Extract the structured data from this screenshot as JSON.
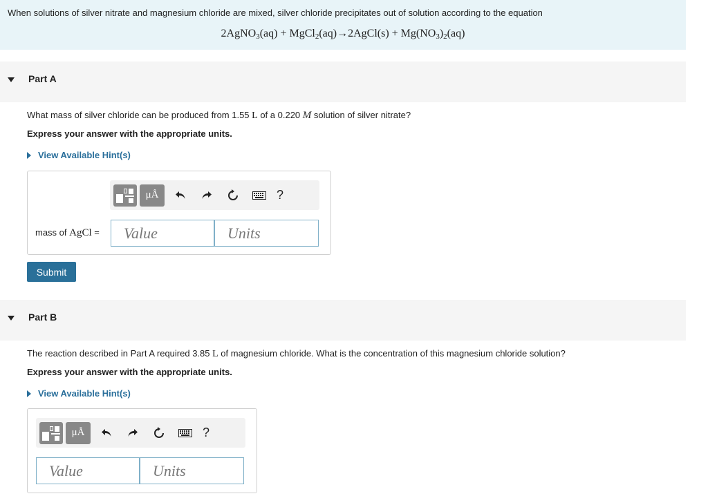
{
  "intro": {
    "text": "When solutions of silver nitrate and magnesium chloride are mixed, silver chloride precipitates out of solution according to the equation",
    "equation": {
      "p1": "2AgNO",
      "s1": "3",
      "p2": "(aq) + MgCl",
      "s2": "2",
      "p3": "(aq)→2AgCl(s) + Mg(NO",
      "s3": "3",
      "p4": ")",
      "s4": "2",
      "p5": "(aq)"
    }
  },
  "partA": {
    "title": "Part A",
    "question": {
      "t1": "What mass of silver chloride can be produced from 1.55 ",
      "u1": "L",
      "t2": " of a 0.220 ",
      "u2": "M",
      "t3": " solution of silver nitrate?"
    },
    "express": "Express your answer with the appropriate units.",
    "hint": "View Available Hint(s)",
    "field_label_prefix": "mass of ",
    "field_label_chem": "AgCl",
    "field_label_suffix": " =",
    "value_placeholder": "Value",
    "units_placeholder": "Units",
    "submit": "Submit"
  },
  "partB": {
    "title": "Part B",
    "question": {
      "t1": "The reaction described in Part A required 3.85 ",
      "u1": "L",
      "t2": " of magnesium chloride. What is the concentration of this magnesium chloride solution?"
    },
    "express": "Express your answer with the appropriate units.",
    "hint": "View Available Hint(s)",
    "value_placeholder": "Value",
    "units_placeholder": "Units"
  },
  "toolbar": {
    "mu_label": "μÅ",
    "help_label": "?",
    "icons": [
      "templates-icon",
      "units-icon",
      "undo-icon",
      "redo-icon",
      "reset-icon",
      "keyboard-icon",
      "help-icon"
    ]
  },
  "colors": {
    "intro_bg": "#e8f4f8",
    "header_bg": "#f5f5f5",
    "link": "#2a6f9b",
    "submit_bg": "#2a7099",
    "input_border": "#7fb0c8",
    "toolbar_btn": "#888888"
  }
}
